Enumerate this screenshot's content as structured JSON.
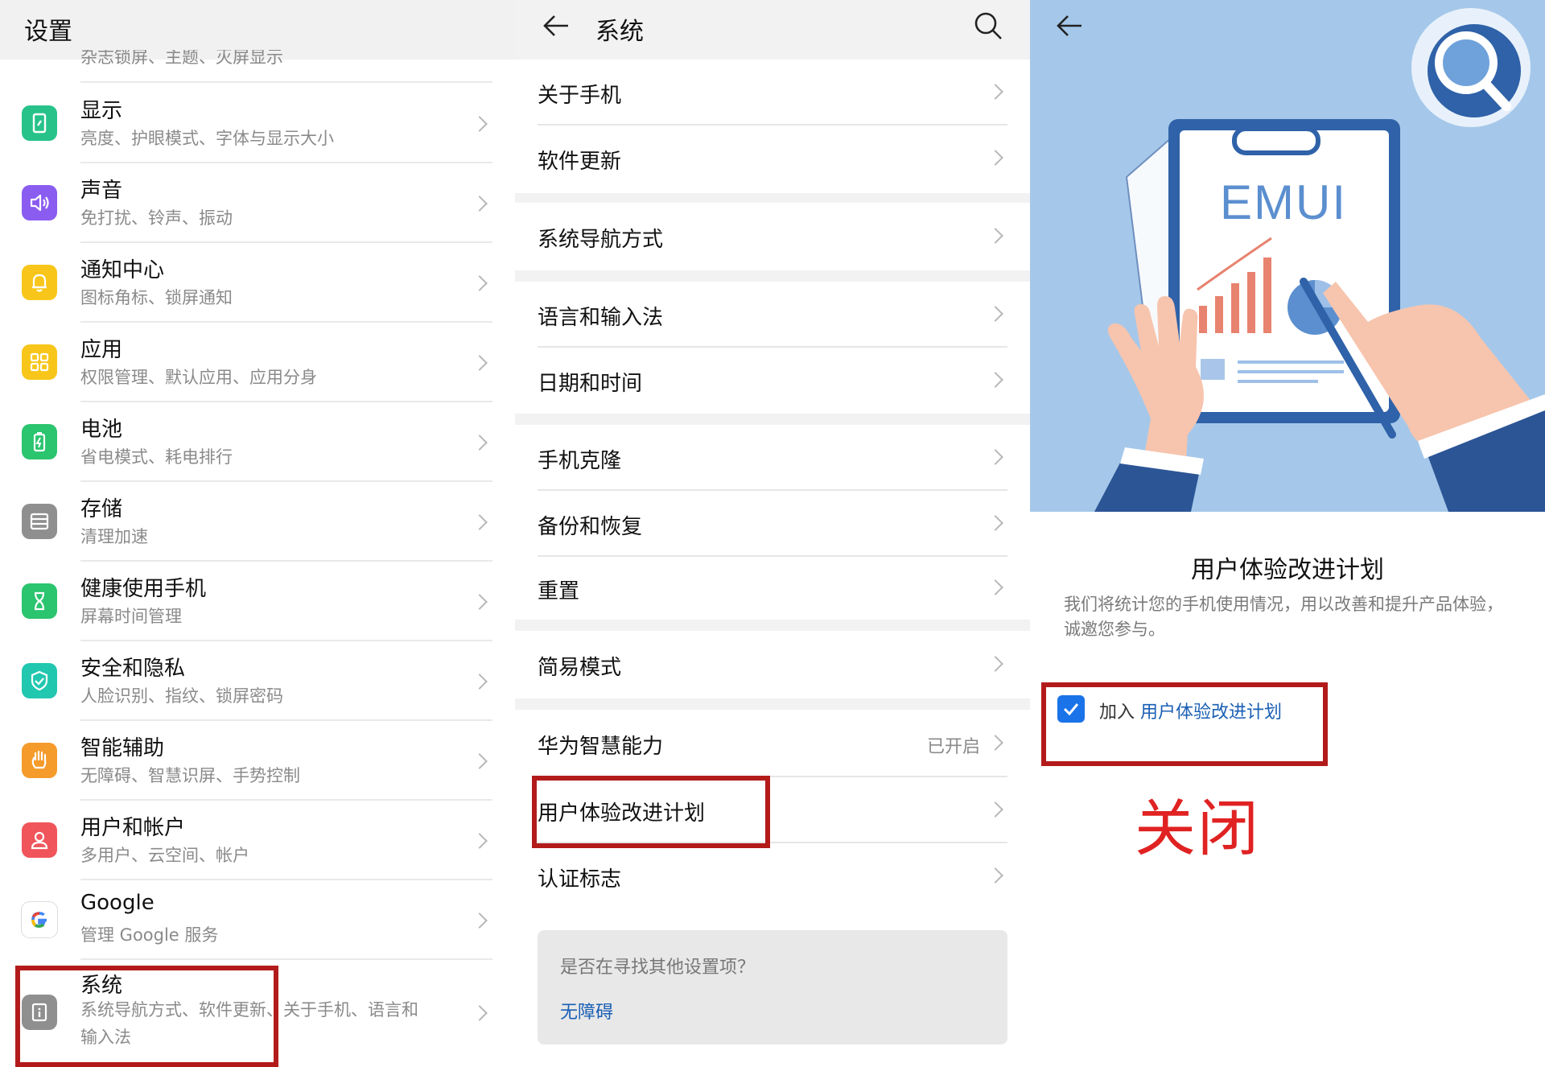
{
  "settings": {
    "title": "设置",
    "cutoff_subtitle": "杂志锁屏、主题、灭屏显示",
    "items": [
      {
        "title": "显示",
        "subtitle": "亮度、护眼模式、字体与显示大小",
        "icon": "display-icon",
        "color": "#27c28a"
      },
      {
        "title": "声音",
        "subtitle": "免打扰、铃声、振动",
        "icon": "sound-icon",
        "color": "#8a5cf0"
      },
      {
        "title": "通知中心",
        "subtitle": "图标角标、锁屏通知",
        "icon": "bell-icon",
        "color": "#f8c61a"
      },
      {
        "title": "应用",
        "subtitle": "权限管理、默认应用、应用分身",
        "icon": "apps-icon",
        "color": "#f8c61a"
      },
      {
        "title": "电池",
        "subtitle": "省电模式、耗电排行",
        "icon": "battery-icon",
        "color": "#2bc46f"
      },
      {
        "title": "存储",
        "subtitle": "清理加速",
        "icon": "storage-icon",
        "color": "#8f8f8f"
      },
      {
        "title": "健康使用手机",
        "subtitle": "屏幕时间管理",
        "icon": "hourglass-icon",
        "color": "#2bc46f"
      },
      {
        "title": "安全和隐私",
        "subtitle": "人脸识别、指纹、锁屏密码",
        "icon": "shield-icon",
        "color": "#22c7b0"
      },
      {
        "title": "智能辅助",
        "subtitle": "无障碍、智慧识屏、手势控制",
        "icon": "hand-icon",
        "color": "#f59b2c"
      },
      {
        "title": "用户和帐户",
        "subtitle": "多用户、云空间、帐户",
        "icon": "user-icon",
        "color": "#f0555b"
      },
      {
        "title": "Google",
        "subtitle": "管理 Google 服务",
        "icon": "google-icon",
        "color": "#ffffff"
      },
      {
        "title": "系统",
        "subtitle_line1": "系统导航方式、软件更新、关于手机、语言和",
        "subtitle_line2": "输入法",
        "icon": "info-icon",
        "color": "#8f8f8f"
      }
    ]
  },
  "system": {
    "title": "系统",
    "items": [
      {
        "label": "关于手机"
      },
      {
        "label": "软件更新"
      },
      {
        "label": "系统导航方式"
      },
      {
        "label": "语言和输入法"
      },
      {
        "label": "日期和时间"
      },
      {
        "label": "手机克隆"
      },
      {
        "label": "备份和恢复"
      },
      {
        "label": "重置"
      },
      {
        "label": "简易模式"
      },
      {
        "label": "华为智慧能力",
        "status": "已开启"
      },
      {
        "label": "用户体验改进计划"
      },
      {
        "label": "认证标志"
      }
    ],
    "card": {
      "question": "是否在寻找其他设置项？",
      "link": "无障碍"
    }
  },
  "ux_plan": {
    "illustration_text": "EMUI",
    "title": "用户体验改进计划",
    "description": "我们将统计您的手机使用情况，用以改善和提升产品体验，诚邀您参与。",
    "join_prefix": "加入",
    "join_link": "用户体验改进计划",
    "checked": true
  },
  "annotation": {
    "text": "关闭",
    "color": "#e02222",
    "box_color": "#b31b1b"
  }
}
